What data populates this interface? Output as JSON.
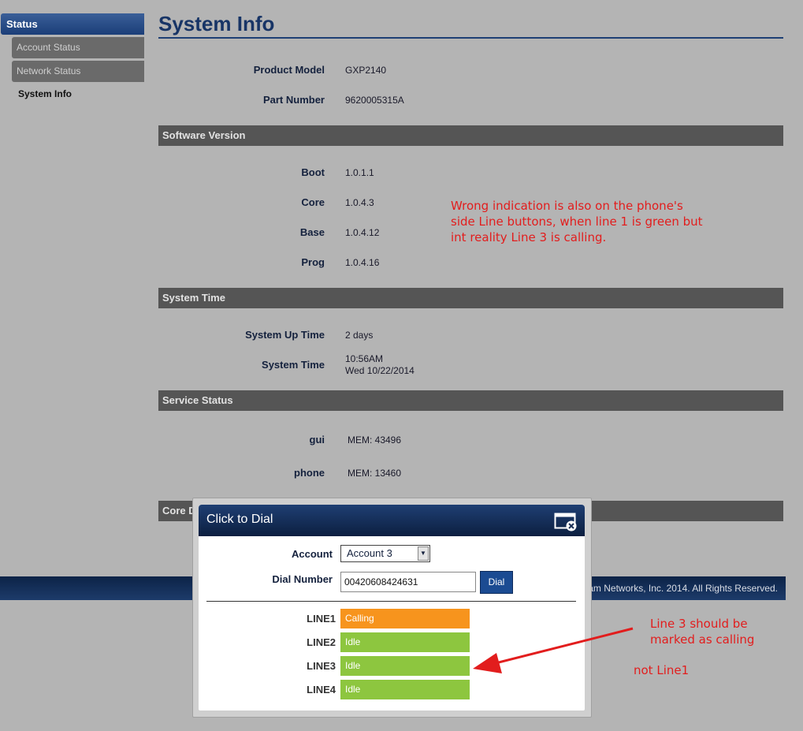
{
  "sidebar": {
    "header": "Status",
    "items": [
      "Account Status",
      "Network Status"
    ],
    "active": "System Info"
  },
  "page": {
    "title": "System Info"
  },
  "product": [
    {
      "label": "Product Model",
      "value": "GXP2140"
    },
    {
      "label": "Part Number",
      "value": "9620005315A"
    }
  ],
  "software": {
    "title": "Software Version",
    "rows": [
      {
        "label": "Boot",
        "value": "1.0.1.1"
      },
      {
        "label": "Core",
        "value": "1.0.4.3"
      },
      {
        "label": "Base",
        "value": "1.0.4.12"
      },
      {
        "label": "Prog",
        "value": "1.0.4.16"
      }
    ]
  },
  "system_time": {
    "title": "System Time",
    "up_label": "System Up Time",
    "up_value": "2 days",
    "time_label": "System Time",
    "time_line1": "10:56AM",
    "time_line2": "Wed 10/22/2014"
  },
  "service": {
    "title": "Service Status",
    "rows": [
      {
        "label": "gui",
        "value": "MEM: 43496"
      },
      {
        "label": "phone",
        "value": "MEM: 13460"
      }
    ]
  },
  "core_dump": {
    "title_visible": "Core D"
  },
  "footer": {
    "text": "am Networks, Inc. 2014. All Rights Reserved."
  },
  "dialog": {
    "title": "Click to Dial",
    "account_label": "Account",
    "account_value": "Account 3",
    "dial_label": "Dial Number",
    "dial_value": "00420608424631",
    "dial_button": "Dial",
    "lines": [
      {
        "label": "LINE1",
        "status": "Calling",
        "color": "#f7941d"
      },
      {
        "label": "LINE2",
        "status": "Idle",
        "color": "#8dc63f"
      },
      {
        "label": "LINE3",
        "status": "Idle",
        "color": "#8dc63f"
      },
      {
        "label": "LINE4",
        "status": "Idle",
        "color": "#8dc63f"
      }
    ]
  },
  "annotations": {
    "note1_l1": "Wrong indication is also on the phone's",
    "note1_l2": "side Line buttons, when line 1 is green but",
    "note1_l3": "int reality Line 3 is calling.",
    "note2_l1": "Line 3 should  be",
    "note2_l2": "marked as calling",
    "note3": "not Line1",
    "color": "#e21d1d"
  }
}
